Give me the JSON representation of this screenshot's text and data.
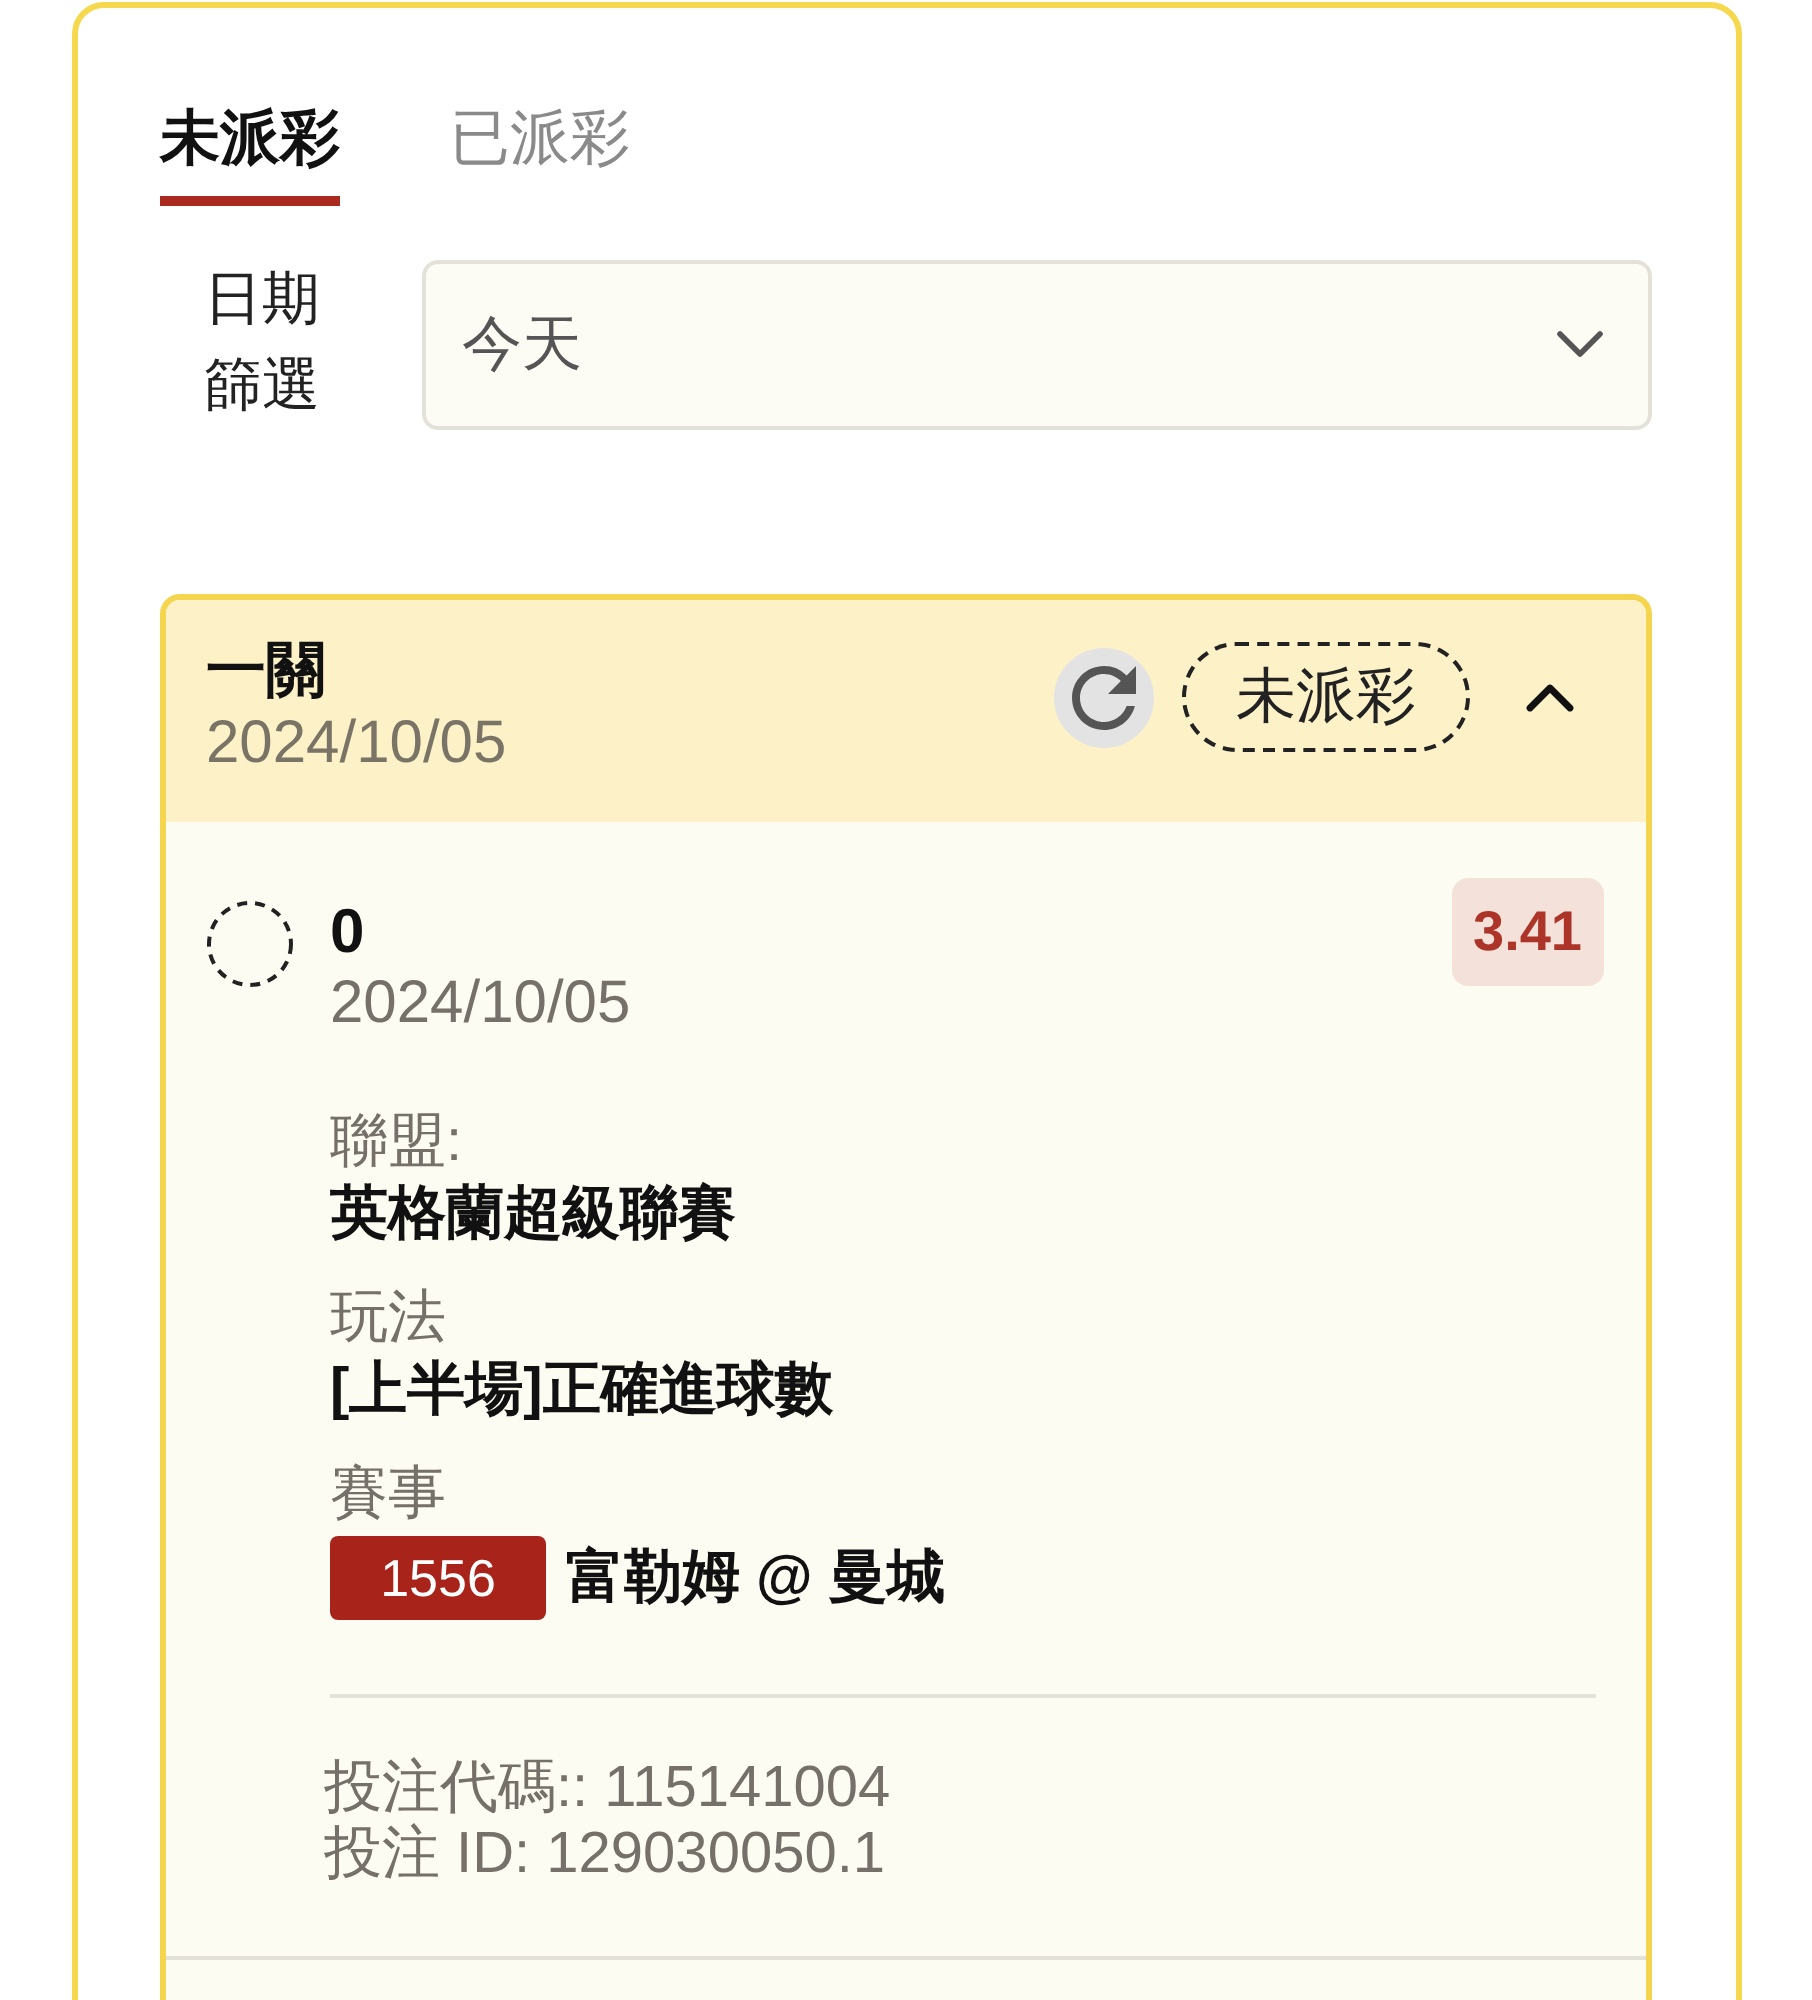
{
  "tabs": [
    {
      "label": "未派彩",
      "selected": true
    },
    {
      "label": "已派彩",
      "selected": false
    }
  ],
  "date_filter": {
    "label": "日期篩選",
    "value": "今天"
  },
  "bets": [
    {
      "title": "一關",
      "date": "2024/10/05",
      "status": "未派彩",
      "expanded": true,
      "selections": [
        {
          "name": "0",
          "date": "2024/10/05",
          "odds": "3.41",
          "fields": [
            {
              "kind": "text",
              "label": "聯盟:",
              "value": "英格蘭超級聯賽"
            },
            {
              "kind": "text",
              "label": "玩法",
              "value": "[上半場]正確進球數"
            },
            {
              "kind": "match",
              "label": "賽事",
              "match_number": "1556",
              "value": "富勒姆 @ 曼城"
            }
          ]
        }
      ],
      "bet_code": "投注代碼:: 115141004",
      "bet_id": "投注 ID: 129030050.1"
    }
  ]
}
